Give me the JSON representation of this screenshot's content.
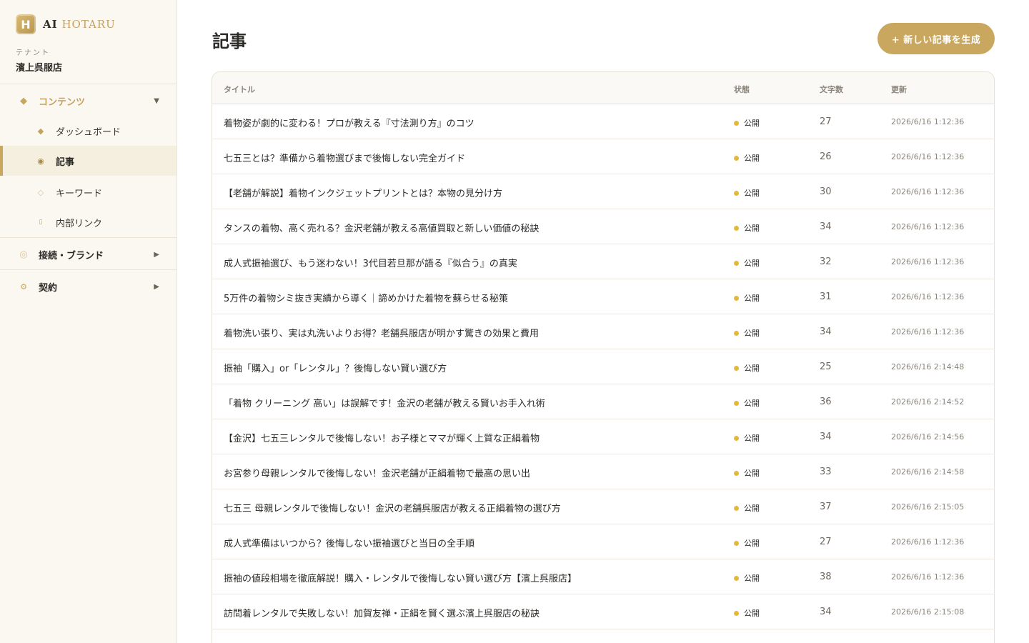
{
  "brand": {
    "logo_letter": "H",
    "name_ai": "AI",
    "name_hotaru": "HOTARU"
  },
  "tenant": {
    "label": "テナント",
    "name": "濱上呉服店"
  },
  "sidebar": {
    "sections": [
      {
        "icon": "◆",
        "label": "コンテンツ",
        "arrow": "▼",
        "expanded": true
      },
      {
        "icon": "◎",
        "label": "接続・ブランド",
        "arrow": "▶",
        "expanded": false
      },
      {
        "icon": "⚙",
        "label": "契約",
        "arrow": "▶",
        "expanded": false
      }
    ],
    "items": [
      {
        "icon": "◆",
        "label": "ダッシュボード",
        "active": false
      },
      {
        "icon": "◉",
        "label": "記事",
        "active": true
      },
      {
        "icon": "◇",
        "label": "キーワード",
        "active": false
      },
      {
        "icon": "▯",
        "label": "内部リンク",
        "active": false
      }
    ]
  },
  "main": {
    "title": "記事",
    "new_button": "+ 新しい記事を生成",
    "columns": [
      "タイトル",
      "状態",
      "文字数",
      "更新"
    ],
    "rows": [
      {
        "title": "着物姿が劇的に変わる！プロが教える『寸法測り方』のコツ",
        "status": "公開",
        "chars": "27",
        "updated": "2026/6/16 1:12:36"
      },
      {
        "title": "七五三とは？準備から着物選びまで後悔しない完全ガイド",
        "status": "公開",
        "chars": "26",
        "updated": "2026/6/16 1:12:36"
      },
      {
        "title": "【老舗が解説】着物インクジェットプリントとは？本物の見分け方",
        "status": "公開",
        "chars": "30",
        "updated": "2026/6/16 1:12:36"
      },
      {
        "title": "タンスの着物、高く売れる？金沢老舗が教える高値買取と新しい価値の秘訣",
        "status": "公開",
        "chars": "34",
        "updated": "2026/6/16 1:12:36"
      },
      {
        "title": "成人式振袖選び、もう迷わない！3代目若旦那が語る『似合う』の真実",
        "status": "公開",
        "chars": "32",
        "updated": "2026/6/16 1:12:36"
      },
      {
        "title": "5万件の着物シミ抜き実績から導く｜諦めかけた着物を蘇らせる秘策",
        "status": "公開",
        "chars": "31",
        "updated": "2026/6/16 1:12:36"
      },
      {
        "title": "着物洗い張り、実は丸洗いよりお得？老舗呉服店が明かす驚きの効果と費用",
        "status": "公開",
        "chars": "34",
        "updated": "2026/6/16 1:12:36"
      },
      {
        "title": "振袖「購入」or「レンタル」？後悔しない賢い選び方",
        "status": "公開",
        "chars": "25",
        "updated": "2026/6/16 2:14:48"
      },
      {
        "title": "「着物 クリーニング 高い」は誤解です！金沢の老舗が教える賢いお手入れ術",
        "status": "公開",
        "chars": "36",
        "updated": "2026/6/16 2:14:52"
      },
      {
        "title": "【金沢】七五三レンタルで後悔しない！お子様とママが輝く上質な正絹着物",
        "status": "公開",
        "chars": "34",
        "updated": "2026/6/16 2:14:56"
      },
      {
        "title": "お宮参り母親レンタルで後悔しない！金沢老舗が正絹着物で最高の思い出",
        "status": "公開",
        "chars": "33",
        "updated": "2026/6/16 2:14:58"
      },
      {
        "title": "七五三 母親レンタルで後悔しない！金沢の老舗呉服店が教える正絹着物の選び方",
        "status": "公開",
        "chars": "37",
        "updated": "2026/6/16 2:15:05"
      },
      {
        "title": "成人式準備はいつから？後悔しない振袖選びと当日の全手順",
        "status": "公開",
        "chars": "27",
        "updated": "2026/6/16 1:12:36"
      },
      {
        "title": "振袖の値段相場を徹底解説！購入・レンタルで後悔しない賢い選び方【濱上呉服店】",
        "status": "公開",
        "chars": "38",
        "updated": "2026/6/16 1:12:36"
      },
      {
        "title": "訪問着レンタルで失敗しない！加賀友禅・正絹を賢く選ぶ濱上呉服店の秘訣",
        "status": "公開",
        "chars": "34",
        "updated": "2026/6/16 2:15:08"
      }
    ]
  },
  "colors": {
    "accent": "#c9a75e",
    "status_dot": "#e2b93b",
    "sidebar_bg": "#fbf8f1"
  }
}
